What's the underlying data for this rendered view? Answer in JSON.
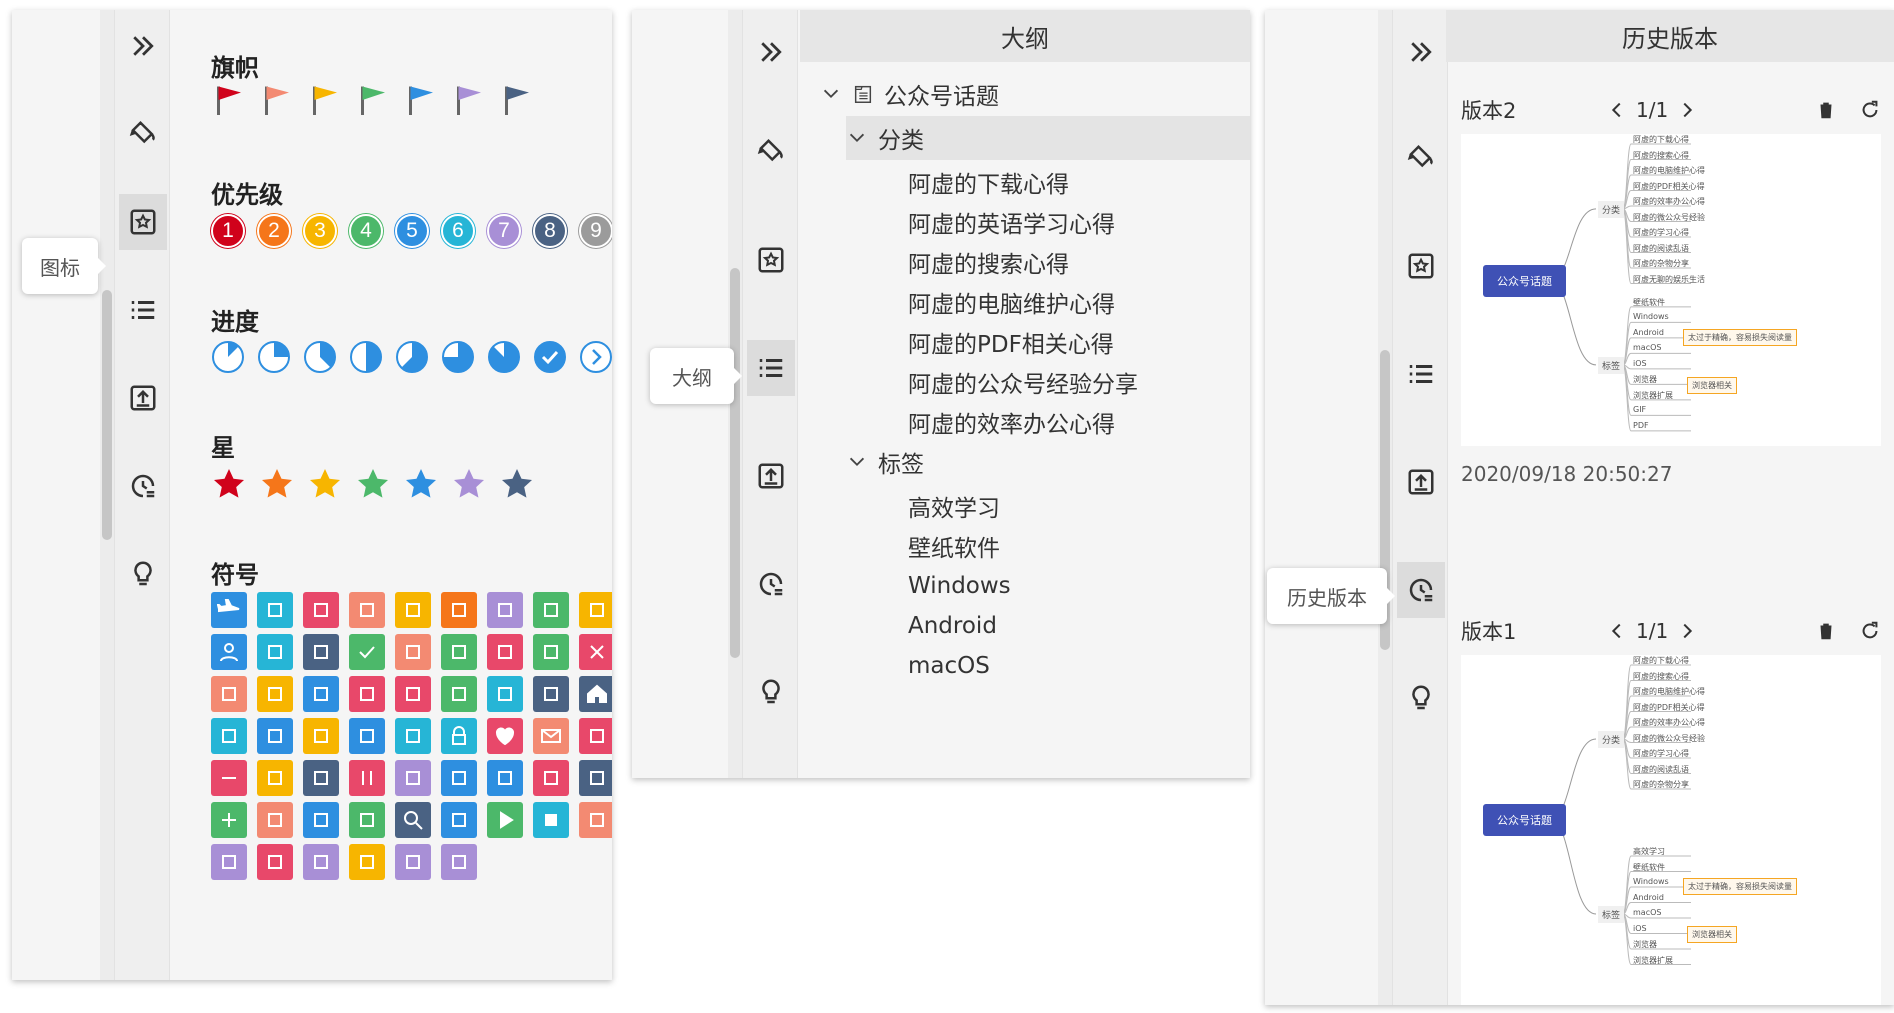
{
  "colors": {
    "red": "#d0021b",
    "orange": "#f5761a",
    "yellow": "#f7b500",
    "green": "#4cb86a",
    "blue": "#2e8fe0",
    "cyan": "#26b5d6",
    "purple": "#a88fd6",
    "navy": "#4a6283",
    "gray": "#9b9b9b",
    "salmon": "#f38a72",
    "pink": "#e8486a",
    "mindmap_root": "#3f51b5"
  },
  "panel1": {
    "tooltip": "图标",
    "sections": {
      "flags": "旗帜",
      "priority": "优先级",
      "progress": "进度",
      "stars": "星",
      "symbols": "符号"
    },
    "priority_numbers": [
      "1",
      "2",
      "3",
      "4",
      "5",
      "6",
      "7",
      "8",
      "9"
    ],
    "flags": [
      "red-flag-icon",
      "salmon-flag-icon",
      "orange-flag-icon",
      "green-flag-icon",
      "blue-flag-icon",
      "purple-flag-icon",
      "navy-flag-icon"
    ],
    "progress_levels": [
      0.125,
      0.25,
      0.375,
      0.5,
      0.625,
      0.75,
      0.875,
      1.0,
      "next"
    ]
  },
  "panel2": {
    "tooltip": "大纲",
    "header": "大纲",
    "root": "公众号话题",
    "group1": "分类",
    "group1_items": [
      "阿虚的下载心得",
      "阿虚的英语学习心得",
      "阿虚的搜索心得",
      "阿虚的电脑维护心得",
      "阿虚的PDF相关心得",
      "阿虚的公众号经验分享",
      "阿虚的效率办公心得"
    ],
    "group2": "标签",
    "group2_items": [
      "高效学习",
      "壁纸软件",
      "Windows",
      "Android",
      "macOS"
    ]
  },
  "panel3": {
    "tooltip": "历史版本",
    "header": "历史版本",
    "versions": [
      {
        "label": "版本2",
        "pager": "1/1",
        "timestamp": "2020/09/18 20:50:27"
      },
      {
        "label": "版本1",
        "pager": "1/1"
      }
    ],
    "mindmap": {
      "root": "公众号话题",
      "branch1": "分类",
      "branch2": "标签",
      "branch1_leaves_v2": [
        "阿虚的下载心得",
        "阿虚的搜索心得",
        "阿虚的电脑维护心得",
        "阿虚的PDF相关心得",
        "阿虚的效率办公心得",
        "阿虚的微公众号经验",
        "阿虚的学习心得",
        "阿虚的阅读乱语",
        "阿虚的杂物分享",
        "阿虚无聊的娱乐生活"
      ],
      "branch2_leaves_v2": [
        "壁纸软件",
        "Windows",
        "Android",
        "macOS",
        "iOS",
        "浏览器",
        "浏览器扩展",
        "GIF",
        "PDF"
      ],
      "branch1_leaves_v1": [
        "阿虚的下载心得",
        "阿虚的搜索心得",
        "阿虚的电脑维护心得",
        "阿虚的PDF相关心得",
        "阿虚的效率办公心得",
        "阿虚的微公众号经验",
        "阿虚的学习心得",
        "阿虚的阅读乱语",
        "阿虚的杂物分享"
      ],
      "branch2_leaves_v1": [
        "高效学习",
        "壁纸软件",
        "Windows",
        "Android",
        "macOS",
        "iOS",
        "浏览器",
        "浏览器扩展"
      ],
      "note1": "太过于精确，容易损失阅读量",
      "note2": "浏览器相关"
    }
  }
}
